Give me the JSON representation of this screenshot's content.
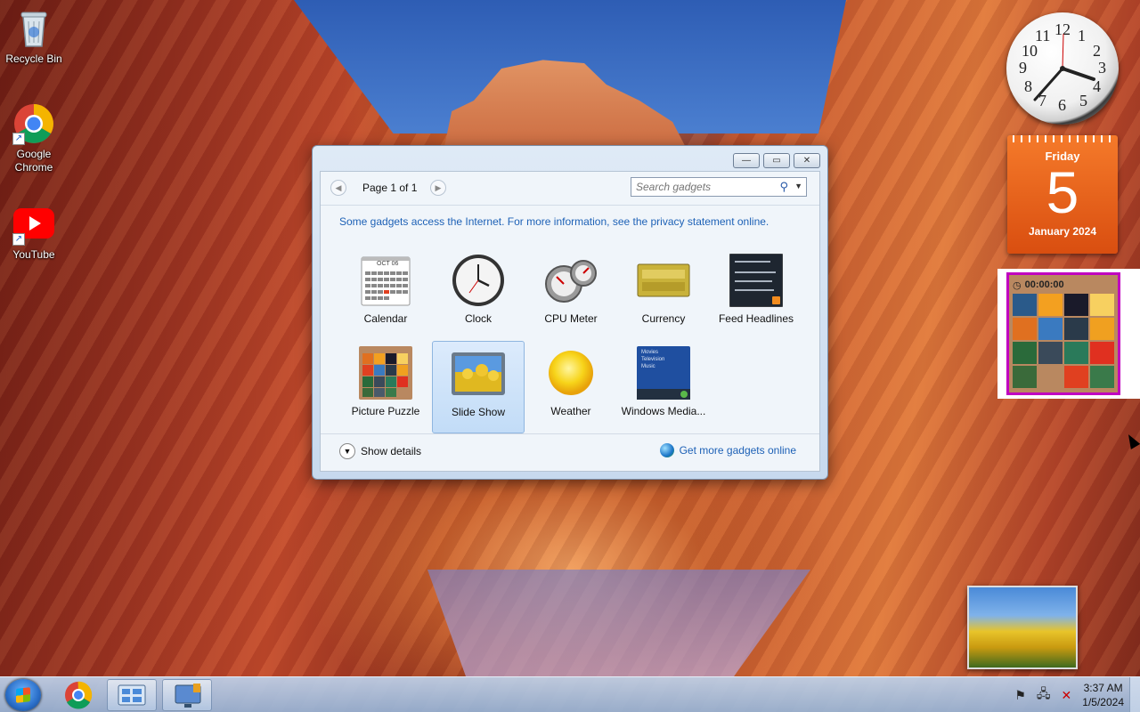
{
  "desktop": {
    "icons": [
      {
        "label": "Recycle Bin"
      },
      {
        "label": "Google\nChrome"
      },
      {
        "label": "YouTube"
      }
    ]
  },
  "sidebar_gadgets": {
    "clock_numbers": [
      "12",
      "1",
      "2",
      "3",
      "4",
      "5",
      "6",
      "7",
      "8",
      "9",
      "10",
      "11"
    ],
    "calendar": {
      "day": "Friday",
      "date": "5",
      "month": "January 2024"
    },
    "puzzle_timer": "00:00:00"
  },
  "window": {
    "controls": {
      "minimize": "—",
      "maximize": "▭",
      "close": "✕"
    },
    "pager": "Page 1 of 1",
    "search_placeholder": "Search gadgets",
    "notice": "Some gadgets access the Internet.  For more information, see the privacy statement online.",
    "gadgets": [
      {
        "label": "Calendar",
        "icon": "calendar-icon"
      },
      {
        "label": "Clock",
        "icon": "clock-icon"
      },
      {
        "label": "CPU Meter",
        "icon": "cpu-meter-icon"
      },
      {
        "label": "Currency",
        "icon": "currency-icon"
      },
      {
        "label": "Feed Headlines",
        "icon": "feed-headlines-icon"
      },
      {
        "label": "Picture Puzzle",
        "icon": "picture-puzzle-icon"
      },
      {
        "label": "Slide Show",
        "icon": "slide-show-icon",
        "selected": true
      },
      {
        "label": "Weather",
        "icon": "weather-icon"
      },
      {
        "label": "Windows Media...",
        "icon": "windows-media-icon"
      }
    ],
    "calendar_thumb_month": "OCT 06",
    "media_thumb_lines": [
      "Movies",
      "Television",
      "Music"
    ],
    "show_details": "Show details",
    "get_more": "Get more gadgets online"
  },
  "taskbar": {
    "time": "3:37 AM",
    "date": "1/5/2024"
  }
}
